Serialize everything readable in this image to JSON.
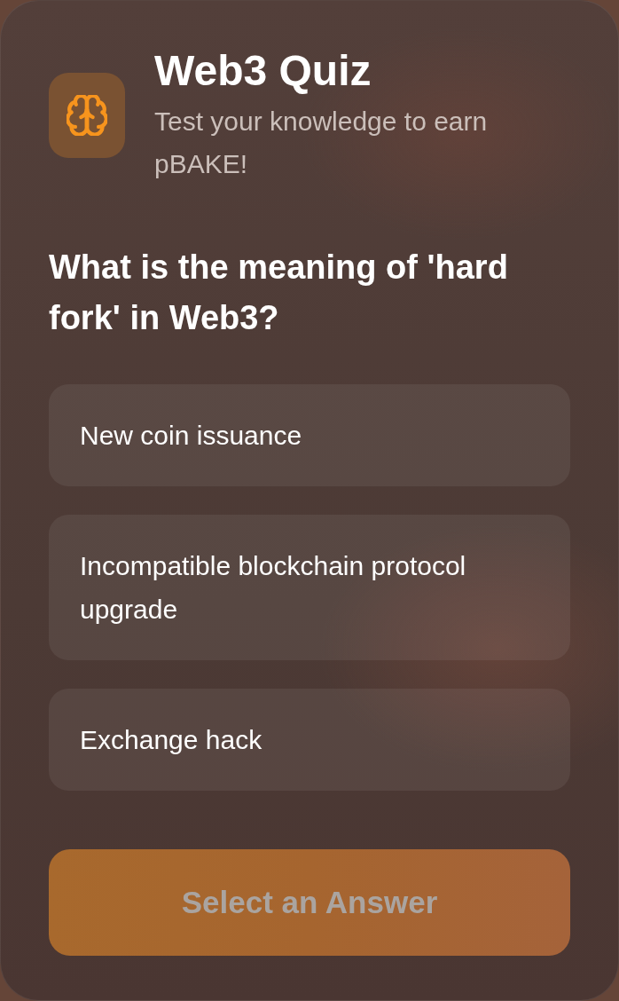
{
  "header": {
    "title": "Web3 Quiz",
    "subtitle": "Test your knowledge to earn pBAKE!"
  },
  "question": "What is the meaning of 'hard fork' in Web3?",
  "options": [
    {
      "label": "New coin issuance",
      "selected": false
    },
    {
      "label": "Incompatible blockchain protocol upgrade",
      "selected": false
    },
    {
      "label": "Exchange hack",
      "selected": false
    }
  ],
  "submit_button": {
    "label": "Select an Answer",
    "disabled": true
  }
}
